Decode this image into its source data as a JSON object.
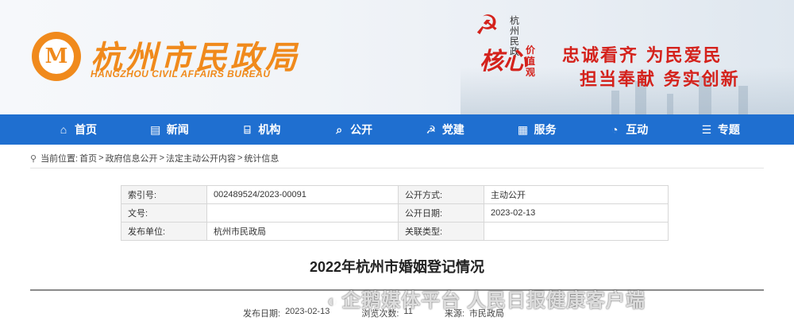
{
  "header": {
    "logo_char": "M",
    "site_title": "杭州市民政局",
    "site_subtitle": "HANGZHOU CIVIL AFFAIRS BUREAU",
    "badge": {
      "party_symbol": "☭",
      "city_text": "杭州民政",
      "heart_text": "核心",
      "values_text": "价值观"
    },
    "slogan_line1": "忠诚看齐  为民爱民",
    "slogan_line2": "担当奉献  务实创新"
  },
  "nav": {
    "items": [
      {
        "label": "首页",
        "icon": "home-icon",
        "glyph": "⌂"
      },
      {
        "label": "新闻",
        "icon": "news-icon",
        "glyph": "▤"
      },
      {
        "label": "机构",
        "icon": "building-icon",
        "glyph": "⌸"
      },
      {
        "label": "公开",
        "icon": "search-doc-icon",
        "glyph": "⌕"
      },
      {
        "label": "党建",
        "icon": "party-icon",
        "glyph": "☭"
      },
      {
        "label": "服务",
        "icon": "grid-icon",
        "glyph": "▦"
      },
      {
        "label": "互动",
        "icon": "chat-icon",
        "glyph": "◔"
      },
      {
        "label": "专题",
        "icon": "list-icon",
        "glyph": "☰"
      }
    ]
  },
  "breadcrumb": {
    "prefix": "当前位置:",
    "items": [
      "首页",
      "政府信息公开",
      "法定主动公开内容",
      "统计信息"
    ],
    "separator": ">"
  },
  "meta": {
    "rows": [
      {
        "k1": "索引号:",
        "v1": "002489524/2023-00091",
        "k2": "公开方式:",
        "v2": "主动公开"
      },
      {
        "k1": "文号:",
        "v1": "",
        "k2": "公开日期:",
        "v2": "2023-02-13"
      },
      {
        "k1": "发布单位:",
        "v1": "杭州市民政局",
        "k2": "关联类型:",
        "v2": ""
      }
    ]
  },
  "article": {
    "title": "2022年杭州市婚姻登记情况",
    "pub_date_label": "发布日期:",
    "pub_date": "2023-02-13",
    "views_label": "浏览次数:",
    "views": "11",
    "source_label": "来源:",
    "source": "市民政局"
  },
  "watermark": {
    "text": "企鹅媒体平台 人民日报健康客户端"
  },
  "colors": {
    "nav_bg": "#1f6fd0",
    "brand_orange": "#f08a1c",
    "slogan_red": "#d4221c"
  }
}
